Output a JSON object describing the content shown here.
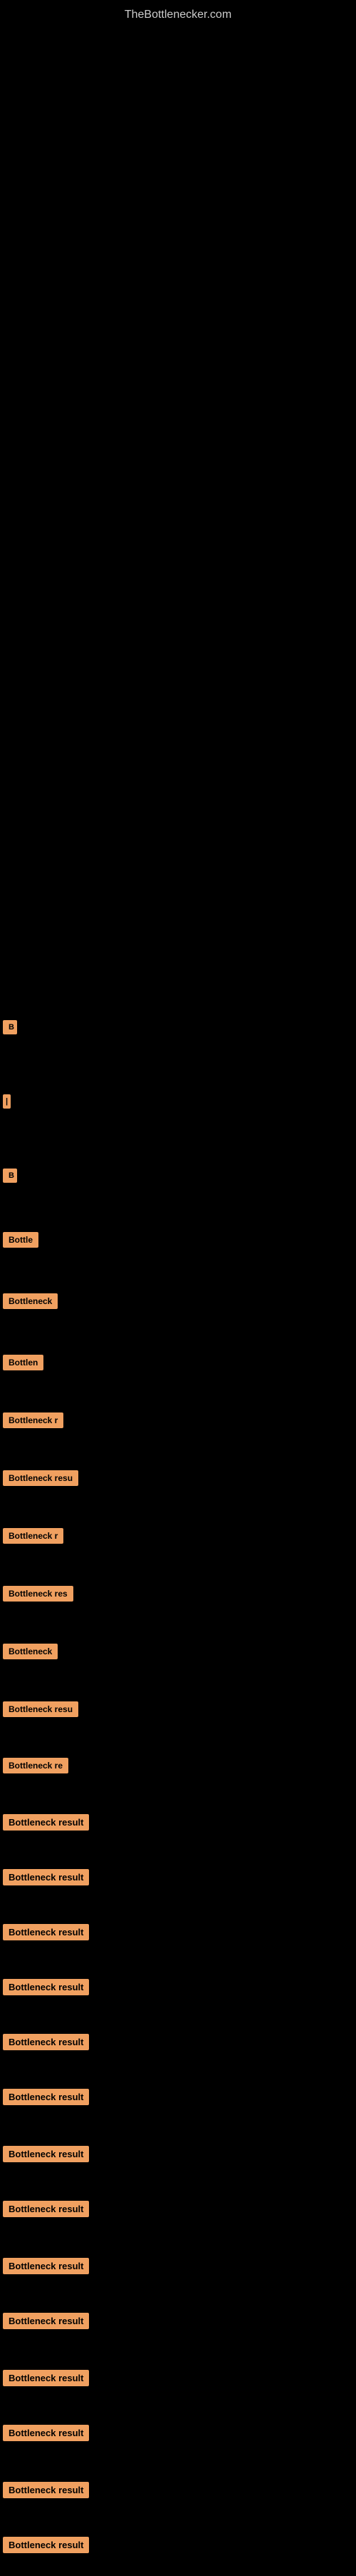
{
  "site": {
    "title": "TheBottlenecker.com"
  },
  "results": [
    {
      "id": 1,
      "label": "B",
      "width": 20
    },
    {
      "id": 2,
      "label": "|",
      "width": 12
    },
    {
      "id": 3,
      "label": "B",
      "width": 20
    },
    {
      "id": 4,
      "label": "Bottle",
      "width": 50
    },
    {
      "id": 5,
      "label": "Bottleneck",
      "width": 80
    },
    {
      "id": 6,
      "label": "Bottlen",
      "width": 65
    },
    {
      "id": 7,
      "label": "Bottleneck r",
      "width": 95
    },
    {
      "id": 8,
      "label": "Bottleneck resu",
      "width": 115
    },
    {
      "id": 9,
      "label": "Bottleneck r",
      "width": 95
    },
    {
      "id": 10,
      "label": "Bottleneck res",
      "width": 110
    },
    {
      "id": 11,
      "label": "Bottleneck",
      "width": 80
    },
    {
      "id": 12,
      "label": "Bottleneck resu",
      "width": 120
    },
    {
      "id": 13,
      "label": "Bottleneck re",
      "width": 105
    },
    {
      "id": 14,
      "label": "Bottleneck result",
      "width": 140
    },
    {
      "id": 15,
      "label": "Bottleneck result",
      "width": 140
    },
    {
      "id": 16,
      "label": "Bottleneck result",
      "width": 140
    },
    {
      "id": 17,
      "label": "Bottleneck result",
      "width": 140
    },
    {
      "id": 18,
      "label": "Bottleneck result",
      "width": 140
    },
    {
      "id": 19,
      "label": "Bottleneck result",
      "width": 140
    },
    {
      "id": 20,
      "label": "Bottleneck result",
      "width": 140
    },
    {
      "id": 21,
      "label": "Bottleneck result",
      "width": 140
    },
    {
      "id": 22,
      "label": "Bottleneck result",
      "width": 140
    },
    {
      "id": 23,
      "label": "Bottleneck result",
      "width": 140
    },
    {
      "id": 24,
      "label": "Bottleneck result",
      "width": 140
    },
    {
      "id": 25,
      "label": "Bottleneck result",
      "width": 140
    },
    {
      "id": 26,
      "label": "Bottleneck result",
      "width": 140
    },
    {
      "id": 27,
      "label": "Bottleneck result",
      "width": 140
    }
  ],
  "colors": {
    "background": "#000000",
    "badge": "#f0a060",
    "text": "#000000",
    "title": "#cccccc"
  }
}
